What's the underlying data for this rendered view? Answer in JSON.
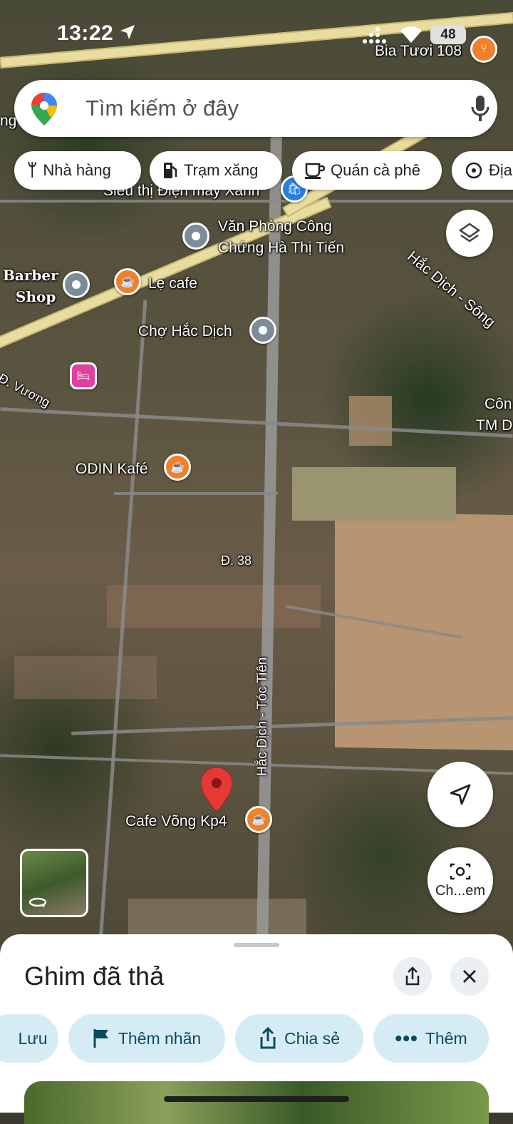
{
  "status_bar": {
    "time": "13:22",
    "battery": "48"
  },
  "search": {
    "placeholder": "Tìm kiếm ở đây"
  },
  "chips": [
    {
      "label": "Nhà hàng",
      "icon": "fork-knife-icon"
    },
    {
      "label": "Trạm xăng",
      "icon": "gas-station-icon"
    },
    {
      "label": "Quán cà phê",
      "icon": "coffee-icon"
    },
    {
      "label": "Địa",
      "icon": "attraction-icon"
    }
  ],
  "map_labels": {
    "bia_tuoi": "Bia Tươi 108",
    "ng": "ng",
    "sieu_thi": "Siêu thị Điện máy Xanh",
    "van_phong_1": "Văn Phòng Công",
    "van_phong_2": "Chứng Hà Thị Tiến",
    "hac_dich_song": "Hắc Dịch - Sông",
    "barber_1": "Barber",
    "barber_2": "Shop",
    "le_cafe": "Lẹ cafe",
    "cho_hac_dich": "Chợ Hắc Dịch",
    "d_vuong": "Đ. Vương",
    "con_1": "Côn",
    "con_2": "TM D",
    "odin": "ODIN Kafé",
    "d38": "Đ. 38",
    "hac_dich_toc_tien": "Hắc Dịch - Tóc Tiên",
    "cafe_vong": "Cafe Võng Kp4"
  },
  "map_buttons": {
    "camera_label": "Ch...em"
  },
  "sheet": {
    "title": "Ghim đã thả",
    "actions": [
      {
        "label": "Lưu"
      },
      {
        "label": "Thêm nhãn"
      },
      {
        "label": "Chia sẻ"
      },
      {
        "label": "Thêm"
      }
    ]
  },
  "colors": {
    "accent": "#0b4a5e",
    "action_bg": "#d6ecf5",
    "pin_red": "#e53935",
    "poi_orange": "#f0802a"
  }
}
